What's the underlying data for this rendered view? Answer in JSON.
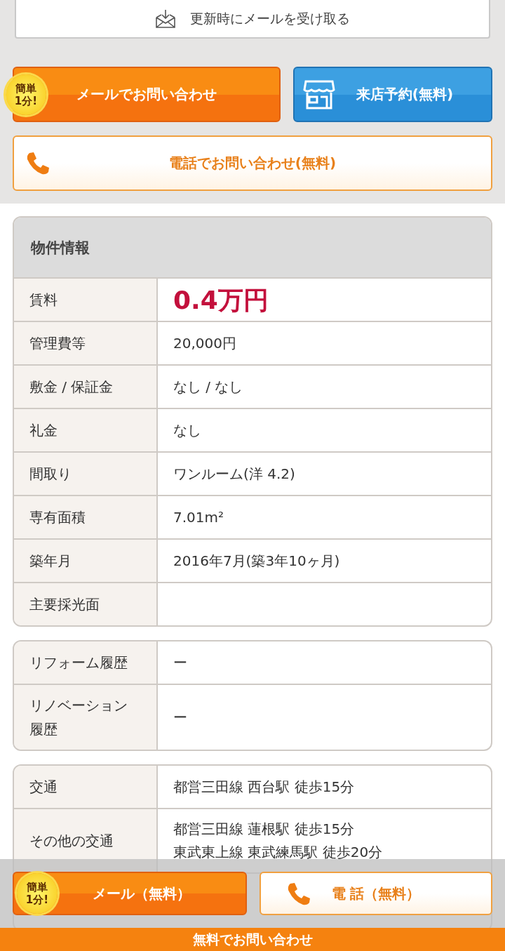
{
  "notify_button": {
    "label": "更新時にメールを受け取る"
  },
  "contact_buttons": [
    {
      "kind": "mail",
      "label": "メールでお問い合わせ",
      "badge": "簡単\n1分!"
    },
    {
      "kind": "visit",
      "label": "来店予約(無料)"
    },
    {
      "kind": "phone",
      "label": "電話でお問い合わせ(無料)"
    }
  ],
  "property_info": {
    "title": "物件情報",
    "sections": [
      [
        {
          "label": "賃料",
          "value": "0.4万円",
          "kind": "price"
        },
        {
          "label": "管理費等",
          "value": "20,000円"
        },
        {
          "label": "敷金 / 保証金",
          "value": "なし / なし"
        },
        {
          "label": "礼金",
          "value": "なし"
        },
        {
          "label": "間取り",
          "value": "ワンルーム(洋 4.2)"
        },
        {
          "label": "専有面積",
          "value": "7.01m²"
        },
        {
          "label": "築年月",
          "value": "2016年7月(築3年10ヶ月)"
        },
        {
          "label": "主要採光面"
        }
      ],
      [
        {
          "label": "リフォーム履歴",
          "value": "ー"
        },
        {
          "label": "リノベーション履歴",
          "value": "ー"
        }
      ],
      [
        {
          "label": "交通",
          "value": "都営三田線 西台駅 徒歩15分"
        },
        {
          "label": "その他の交通",
          "lines": [
            "都営三田線 蓮根駅 徒歩15分",
            "東武東上線 東武練馬駅 徒歩20分"
          ]
        }
      ]
    ]
  },
  "sticky_bar": {
    "buttons": [
      {
        "kind": "mail",
        "label": "メール（無料）",
        "badge": "簡単\n1分!"
      },
      {
        "kind": "phone",
        "label": "電 話（無料）"
      }
    ],
    "footer": "無料でお問い合わせ"
  }
}
